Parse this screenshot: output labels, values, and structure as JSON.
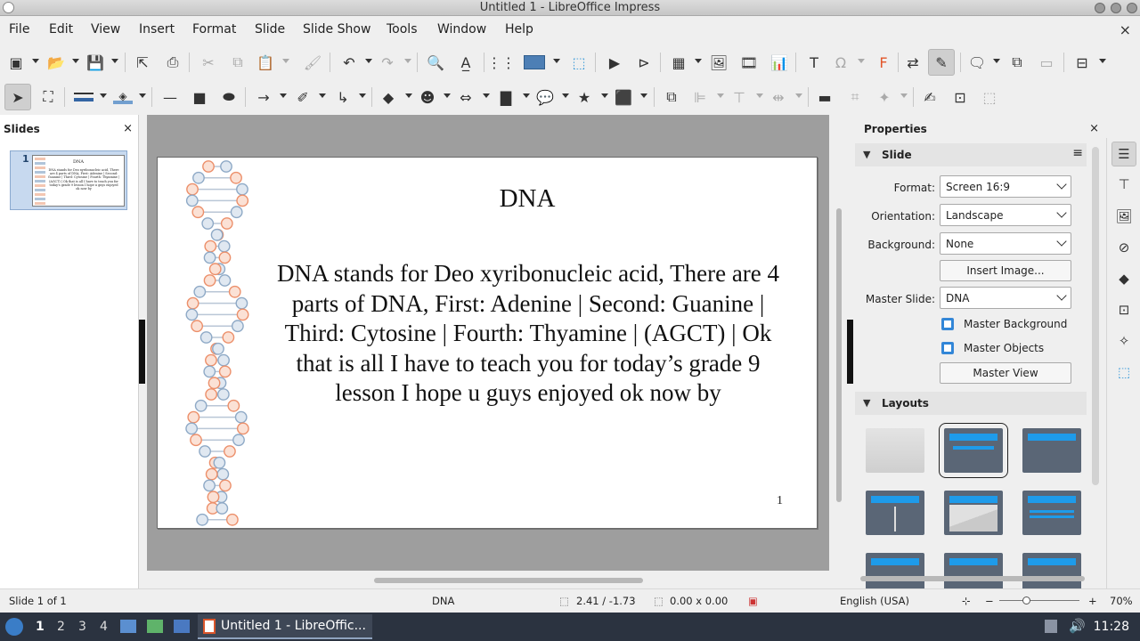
{
  "window": {
    "title": "Untitled 1 - LibreOffice Impress"
  },
  "menubar": {
    "items": [
      "File",
      "Edit",
      "View",
      "Insert",
      "Format",
      "Slide",
      "Slide Show",
      "Tools",
      "Window",
      "Help"
    ],
    "close": "×"
  },
  "slides_pane": {
    "header": "Slides",
    "close": "×",
    "thumb": {
      "number": "1",
      "title": "DNA",
      "body": "DNA stands for Deo xyribonucleic acid, There are 4 parts of DNA, First: Adenine | Second: Guanine | Third: Cytosine | Fourth: Thyamine | (AGCT) | Ok that is all I have to teach you for today's grade 9 lesson I hope u guys enjoyed ok now by"
    }
  },
  "slide": {
    "title": "DNA",
    "body": "DNA stands for Deo xyribonucleic acid, There are 4 parts of DNA, First: Adenine | Second: Guanine | Third: Cytosine | Fourth: Thyamine | (AGCT) | Ok that is all I have to teach you for today’s grade 9 lesson I hope u guys enjoyed ok now by",
    "page_number": "1",
    "colors": {
      "orange": "#ec8f6a",
      "blue": "#8ea9c6"
    }
  },
  "properties": {
    "header": "Properties",
    "close": "×",
    "slide_section": {
      "label": "Slide",
      "format_label": "Format:",
      "format_value": "Screen 16:9",
      "orientation_label": "Orientation:",
      "orientation_value": "Landscape",
      "background_label": "Background:",
      "background_value": "None",
      "insert_image": "Insert Image...",
      "master_slide_label": "Master Slide:",
      "master_slide_value": "DNA",
      "master_background": "Master Background",
      "master_objects": "Master Objects",
      "master_view": "Master View"
    },
    "layouts_section": {
      "label": "Layouts"
    }
  },
  "statusbar": {
    "slide_info": "Slide 1 of 1",
    "master_name": "DNA",
    "position": "2.41 / -1.73",
    "size": "0.00 x 0.00",
    "language": "English (USA)",
    "zoom_minus": "−",
    "zoom_plus": "+",
    "zoom": "70%"
  },
  "taskbar": {
    "workspaces": [
      "1",
      "2",
      "3",
      "4"
    ],
    "task_label": "Untitled 1 - LibreOffic...",
    "clock": "11:28"
  }
}
